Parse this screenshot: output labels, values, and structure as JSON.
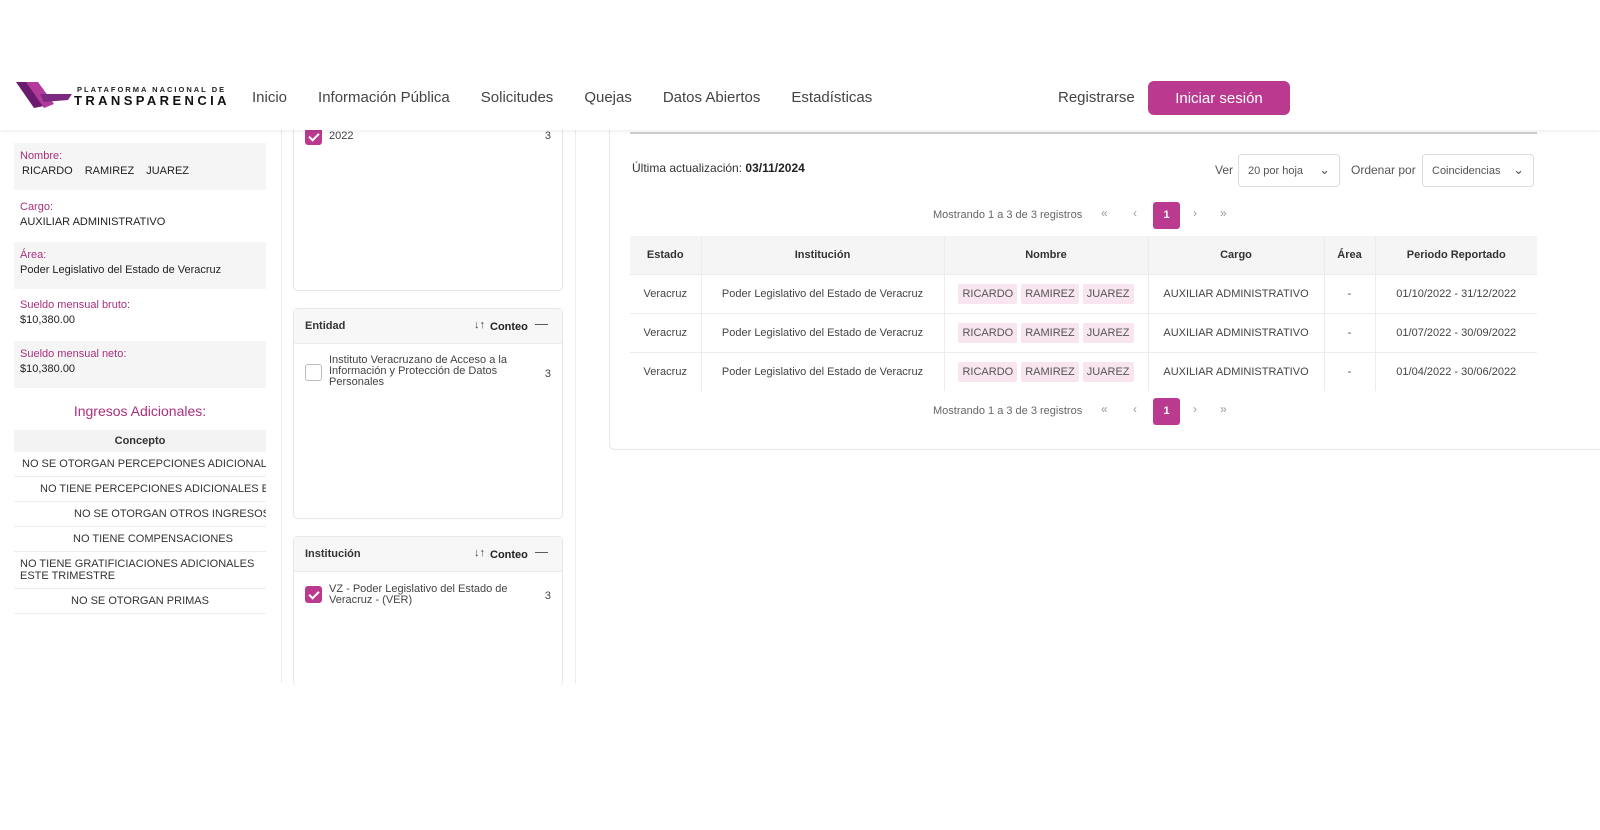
{
  "header": {
    "logo_top": "PLATAFORMA NACIONAL DE",
    "logo_bottom": "TRANSPARENCIA",
    "nav": [
      "Inicio",
      "Información Pública",
      "Solicitudes",
      "Quejas",
      "Datos Abiertos",
      "Estadísticas"
    ],
    "register": "Registrarse",
    "login": "Iniciar sesión",
    "accent": "#ba3a8f"
  },
  "person": {
    "name_label": "Nombre:",
    "name_parts": [
      "RICARDO",
      "RAMIREZ",
      "JUAREZ"
    ],
    "cargo_label": "Cargo:",
    "cargo": "AUXILIAR ADMINISTRATIVO",
    "area_label": "Área:",
    "area": "Poder Legislativo del Estado de Veracruz",
    "bruto_label": "Sueldo mensual bruto:",
    "bruto": "$10,380.00",
    "neto_label": "Sueldo mensual neto:",
    "neto": "$10,380.00",
    "extra_title": "Ingresos Adicionales:",
    "concept_header": "Concepto",
    "concepts": [
      "NO SE OTORGAN PERCEPCIONES ADICIONALES EN",
      "NO TIENE PERCEPCIONES ADICIONALES EN E",
      "NO SE OTORGAN OTROS INGRESOS",
      "NO TIENE COMPENSACIONES",
      "NO TIENE GRATIFICIACIONES ADICIONALES ESTE TRIMESTRE",
      "NO SE OTORGAN PRIMAS"
    ]
  },
  "filters": {
    "year": {
      "label": "2022",
      "count": "3",
      "checked": true
    },
    "entidad": {
      "title": "Entidad",
      "sort_label": "Conteo",
      "item": "Instituto Veracruzano de Acceso a la Información y Protección de Datos Personales",
      "count": "3",
      "checked": false
    },
    "institucion": {
      "title": "Institución",
      "sort_label": "Conteo",
      "item": "VZ - Poder Legislativo del Estado de Veracruz - (VER)",
      "count": "3",
      "checked": true
    }
  },
  "results": {
    "last_update_label": "Última actualización:",
    "last_update": "03/11/2024",
    "ver_label": "Ver",
    "per_page": "20 por hoja",
    "order_label": "Ordenar por",
    "order": "Coincidencias",
    "pager_text": "Mostrando 1 a 3 de 3 registros",
    "current_page": "1",
    "columns": [
      "Estado",
      "Institución",
      "Nombre",
      "Cargo",
      "Área",
      "Periodo Reportado"
    ],
    "rows": [
      {
        "estado": "Veracruz",
        "institucion": "Poder Legislativo del Estado de Veracruz",
        "nombre": [
          "RICARDO",
          "RAMIREZ",
          "JUAREZ"
        ],
        "cargo": "AUXILIAR ADMINISTRATIVO",
        "area": "-",
        "periodo": "01/10/2022 - 31/12/2022"
      },
      {
        "estado": "Veracruz",
        "institucion": "Poder Legislativo del Estado de Veracruz",
        "nombre": [
          "RICARDO",
          "RAMIREZ",
          "JUAREZ"
        ],
        "cargo": "AUXILIAR ADMINISTRATIVO",
        "area": "-",
        "periodo": "01/07/2022 - 30/09/2022"
      },
      {
        "estado": "Veracruz",
        "institucion": "Poder Legislativo del Estado de Veracruz",
        "nombre": [
          "RICARDO",
          "RAMIREZ",
          "JUAREZ"
        ],
        "cargo": "AUXILIAR ADMINISTRATIVO",
        "area": "-",
        "periodo": "01/04/2022 - 30/06/2022"
      }
    ]
  }
}
